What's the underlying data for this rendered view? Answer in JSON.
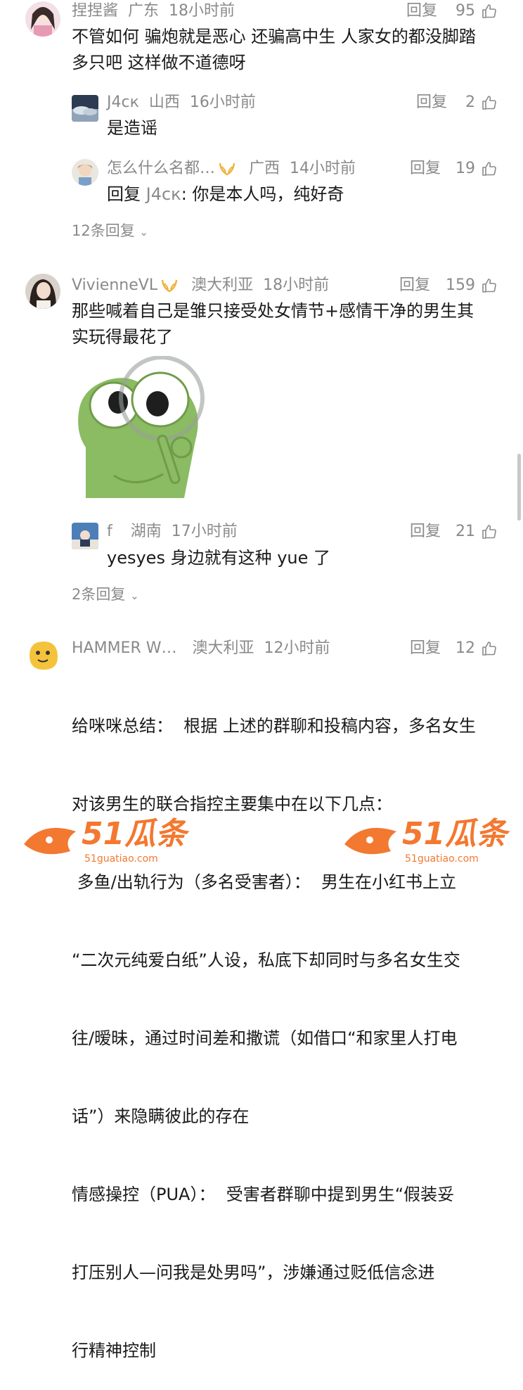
{
  "comments": [
    {
      "user": "捏捏酱",
      "location": "广东",
      "time": "18小时前",
      "likes": "95",
      "text_lines": [
        "不管如何 骗炮就是恶心 还骗高中生 人家女的都没脚踏",
        "多只吧 这样做不道德呀"
      ],
      "replies": [
        {
          "user": "J4ск",
          "location": "山西",
          "time": "16小时前",
          "likes": "2",
          "text": "是造谣"
        },
        {
          "user": "怎么什么名都…",
          "location": "广西",
          "time": "14小时前",
          "likes": "19",
          "text": "回复 J4ск: 你是本人吗，纯好奇",
          "reply_prefix": "回复 ",
          "reply_to": "J4ск",
          "reply_body": ": 你是本人吗，纯好奇"
        }
      ],
      "more_replies": "12条回复"
    },
    {
      "user": "VivienneVL",
      "location": "澳大利亚",
      "time": "18小时前",
      "likes": "159",
      "text_lines": [
        "那些喊着自己是雏只接受处女情节+感情干净的男生其",
        "实玩得最花了"
      ],
      "sticker": "frog-magnifier-sticker",
      "replies": [
        {
          "user": "f",
          "location": "湖南",
          "time": "17小时前",
          "likes": "21",
          "text": "yesyes 身边就有这种 yue 了"
        }
      ],
      "more_replies": "2条回复"
    },
    {
      "user": "HAMMER W…",
      "location": "澳大利亚",
      "time": "12小时前",
      "likes": "12",
      "text_lines": [
        "给咪咪总结：  根据 上述的群聊和投稿内容，多名女生",
        "对该男生的联合指控主要集中在以下几点：",
        " 多鱼/出轨行为（多名受害者）：  男生在小红书上立",
        "“二次元纯爱白纸”人设，私底下却同时与多名女生交",
        "往/暧昧，通过时间差和撒谎（如借口“和家里人打电",
        "话”）来隐瞒彼此的存在",
        "情感操控（PUA）：  受害者群聊中提到男生“假装妥",
        "打压别人—问我是处男吗”，涉嫌通过贬低信念进",
        "行精神控制"
      ]
    }
  ],
  "labels": {
    "reply": "回复"
  },
  "watermark": {
    "text": "51瓜条",
    "url": "51guatiao.com",
    "color": "#f26d1f"
  }
}
